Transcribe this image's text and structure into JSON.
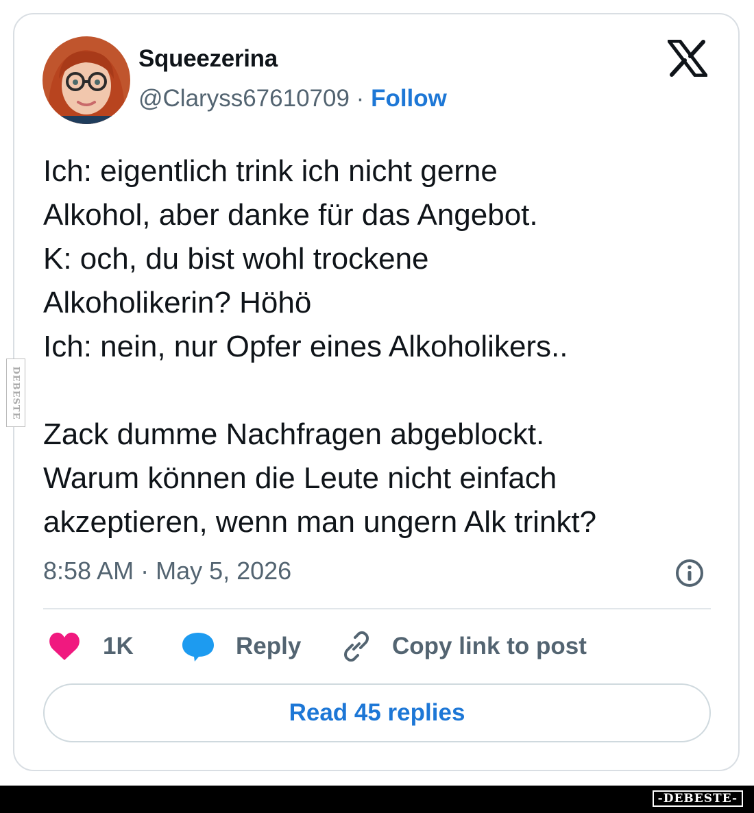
{
  "tweet": {
    "display_name": "Squeezerina",
    "handle": "@Claryss67610709",
    "separator": "·",
    "follow_label": "Follow",
    "text": "Ich: eigentlich trink ich nicht gerne\nAlkohol, aber danke für das Angebot.\nK: och, du bist wohl trockene\nAlkoholikerin? Höhö\nIch: nein, nur Opfer eines Alkoholikers..\n\nZack dumme Nachfragen abgeblockt.\nWarum können die Leute nicht einfach\nakzeptieren, wenn man ungern Alk trinkt?",
    "timestamp": "8:58 AM · May 5, 2026"
  },
  "actions": {
    "like_count": "1K",
    "reply_label": "Reply",
    "copy_label": "Copy link to post"
  },
  "footer": {
    "read_replies_label": "Read 45 replies"
  },
  "watermarks": {
    "side": "DEBESTE",
    "bottom": "-DEBESTE-"
  },
  "icons": {
    "platform": "x-logo-icon",
    "info": "info-icon",
    "like": "heart-icon",
    "reply": "speech-bubble-icon",
    "copy": "link-icon"
  },
  "colors": {
    "accent": "#1d77d6",
    "like": "#f0197f",
    "reply": "#1d9bf0",
    "secondary_text": "#536471",
    "border": "#d9dee3"
  }
}
